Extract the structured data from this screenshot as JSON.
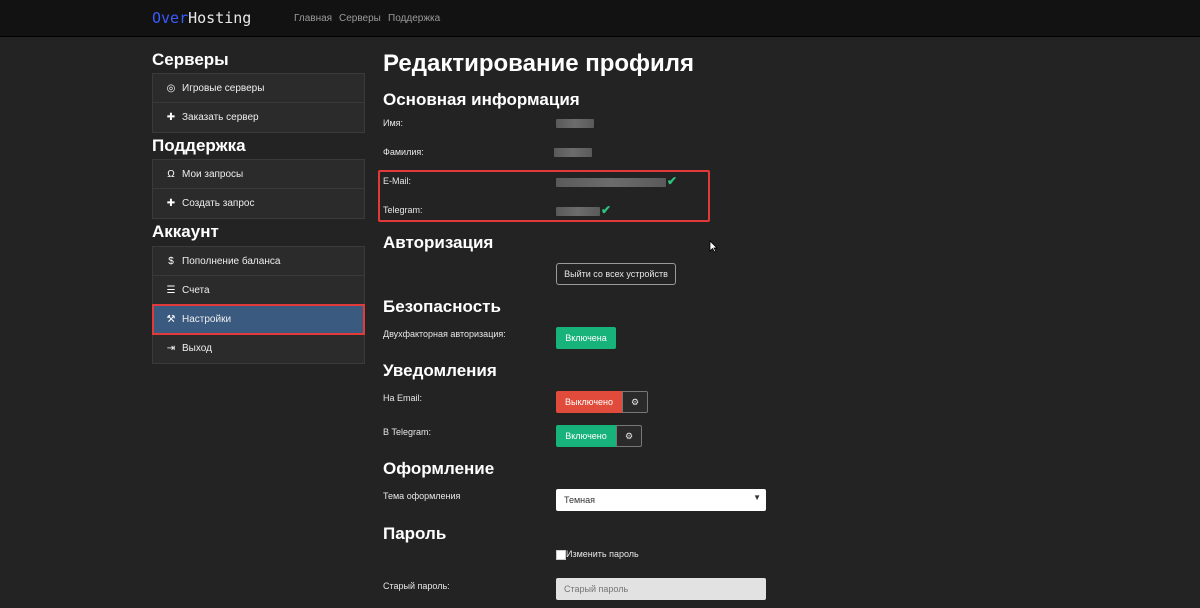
{
  "topbar": {
    "brand_part1": "Over",
    "brand_part2": "Hosting",
    "nav": [
      "Главная",
      "Серверы",
      "Поддержка"
    ]
  },
  "sidebar": {
    "sections": [
      {
        "title": "Серверы",
        "items": [
          {
            "icon": "gamepad-icon",
            "label": "Игровые серверы"
          },
          {
            "icon": "plus-icon",
            "label": "Заказать сервер"
          }
        ]
      },
      {
        "title": "Поддержка",
        "items": [
          {
            "icon": "headphones-icon",
            "label": "Мои запросы"
          },
          {
            "icon": "plus-icon",
            "label": "Создать запрос"
          }
        ]
      },
      {
        "title": "Аккаунт",
        "items": [
          {
            "icon": "dollar-icon",
            "label": "Пополнение баланса"
          },
          {
            "icon": "list-icon",
            "label": "Счета"
          },
          {
            "icon": "wrench-icon",
            "label": "Настройки",
            "active": true
          },
          {
            "icon": "sign-out-icon",
            "label": "Выход"
          }
        ]
      }
    ]
  },
  "main": {
    "page_title": "Редактирование профиля",
    "basic": {
      "title": "Основная информация",
      "name_label": "Имя:",
      "surname_label": "Фамилия:",
      "email_label": "E-Mail:",
      "telegram_label": "Telegram:"
    },
    "auth": {
      "title": "Авторизация",
      "logout_all_label": "Выйти со всех устройств"
    },
    "security": {
      "title": "Безопасность",
      "twofa_label": "Двухфакторная авторизация:",
      "twofa_status": "Включена"
    },
    "notifications": {
      "title": "Уведомления",
      "email_label": "На Email:",
      "email_status": "Выключено",
      "telegram_label": "В Telegram:",
      "telegram_status": "Включено"
    },
    "appearance": {
      "title": "Оформление",
      "theme_label": "Тема оформления",
      "theme_value": "Темная"
    },
    "password": {
      "title": "Пароль",
      "change_label": "Изменить пароль",
      "old_label": "Старый пароль:",
      "old_placeholder": "Старый пароль"
    }
  },
  "colors": {
    "accent_active": "#3b5a80",
    "highlight": "#e03a3a",
    "success": "#18b37a",
    "danger": "#e14b3b"
  }
}
